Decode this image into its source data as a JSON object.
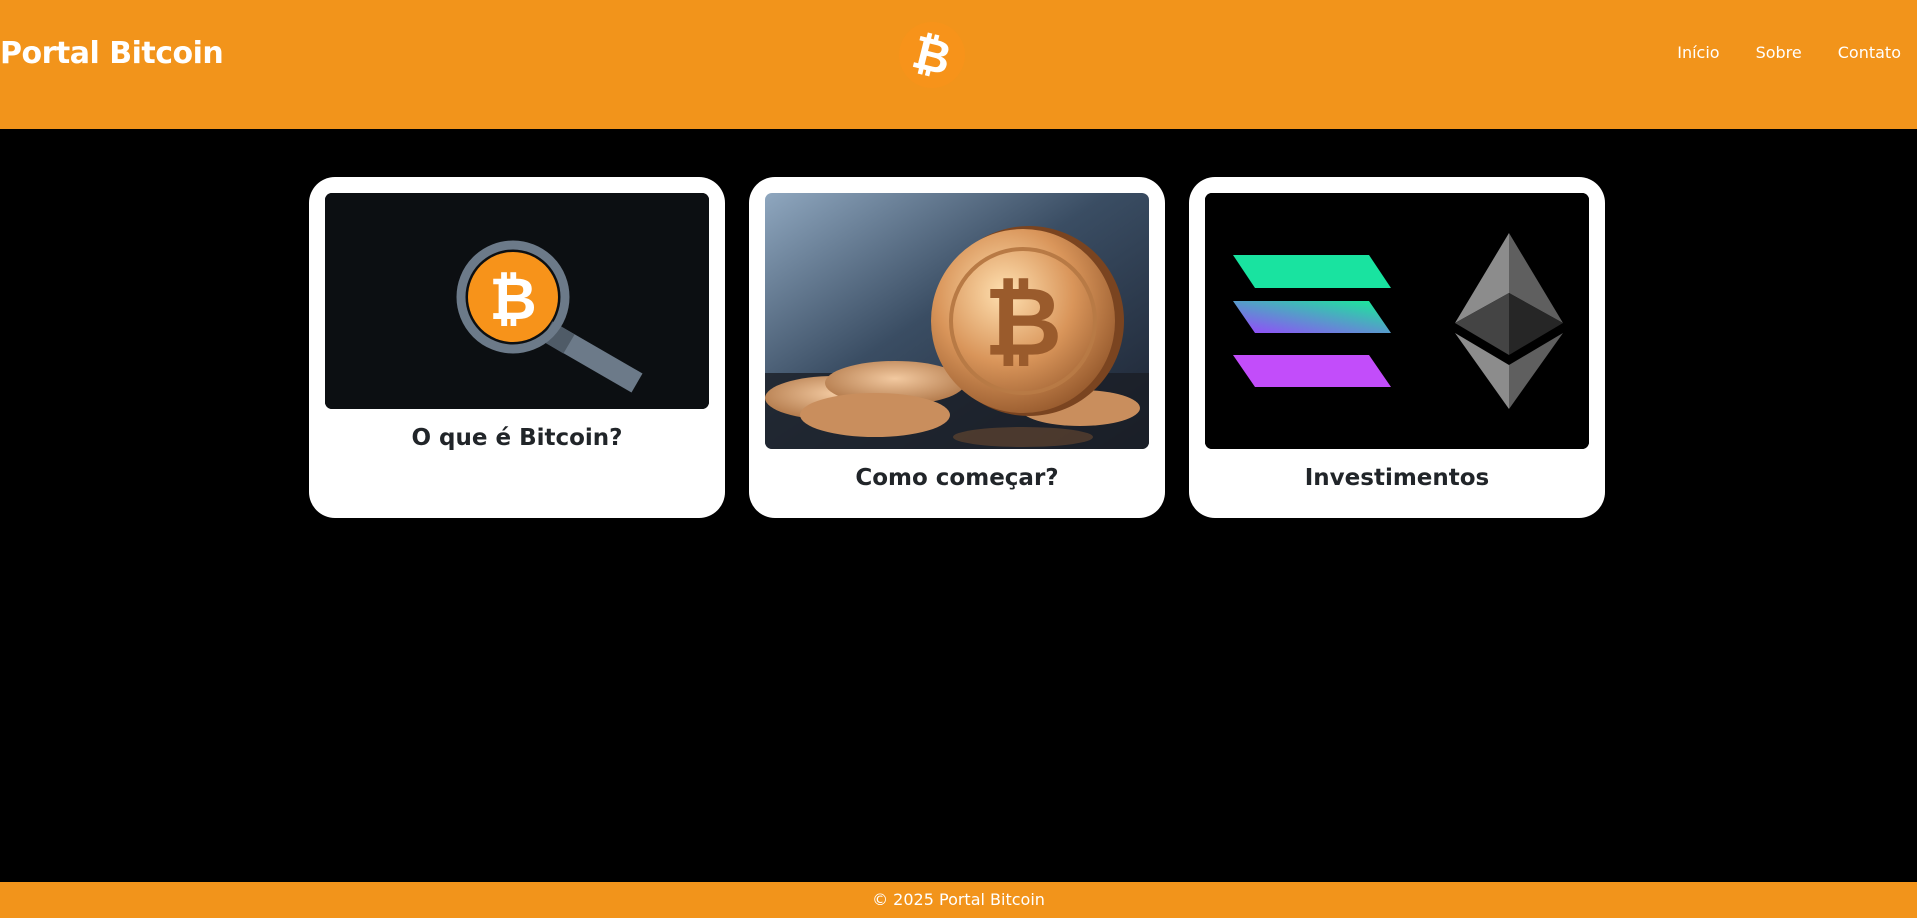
{
  "header": {
    "brand": "Portal Bitcoin",
    "logo_icon": "bitcoin-logo-icon",
    "nav": [
      {
        "label": "Início"
      },
      {
        "label": "Sobre"
      },
      {
        "label": "Contato"
      }
    ]
  },
  "cards": [
    {
      "title": "O que é Bitcoin?",
      "image": "bitcoin-magnifier-image"
    },
    {
      "title": "Como começar?",
      "image": "bitcoin-coins-photo"
    },
    {
      "title": "Investimentos",
      "image": "solana-ethereum-logos-image"
    }
  ],
  "footer": {
    "text": "© 2025 Portal Bitcoin"
  },
  "colors": {
    "brand_orange": "#f2941b",
    "background": "#000000",
    "card_background": "#ffffff",
    "title_text": "#212529"
  }
}
